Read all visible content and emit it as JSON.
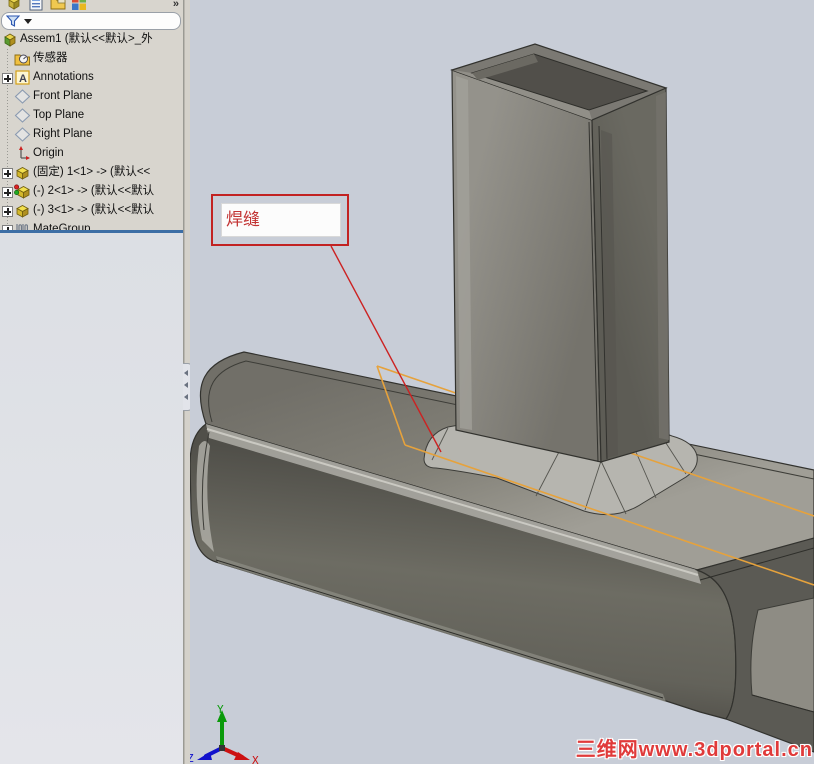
{
  "left_panel": {
    "toolbar": {
      "icons": [
        "feature-manager-icon",
        "property-manager-icon",
        "configuration-manager-icon",
        "addins-manager-icon"
      ],
      "overflow_label": "»"
    },
    "filter": {
      "icon": "filter-funnel-icon"
    },
    "tree": {
      "items": [
        {
          "icon": "assembly-icon",
          "label": "Assem1 (默认<<默认>_外",
          "expandable": false,
          "root": true
        },
        {
          "icon": "sensors-icon",
          "label": "传感器",
          "expandable": false
        },
        {
          "icon": "annotations-icon",
          "label": "Annotations",
          "expandable": true
        },
        {
          "icon": "plane-icon",
          "label": "Front Plane",
          "expandable": false
        },
        {
          "icon": "plane-icon",
          "label": "Top Plane",
          "expandable": false
        },
        {
          "icon": "plane-icon",
          "label": "Right Plane",
          "expandable": false
        },
        {
          "icon": "origin-icon",
          "label": "Origin",
          "expandable": false
        },
        {
          "icon": "part-icon",
          "label": "(固定) 1<1> -> (默认<<",
          "expandable": true
        },
        {
          "icon": "part-alert-icon",
          "label": "(-) 2<1> -> (默认<<默认",
          "expandable": true
        },
        {
          "icon": "part-icon",
          "label": "(-) 3<1> -> (默认<<默认",
          "expandable": true
        },
        {
          "icon": "mategroup-icon",
          "label": "MateGroup",
          "expandable": true
        }
      ]
    }
  },
  "viewport": {
    "annotation": {
      "text": "焊缝"
    },
    "triad": {
      "x_label": "X",
      "y_label": "Y",
      "z_label": "Z"
    },
    "watermark": "三维网www.3dportal.cn",
    "colors": {
      "annotation_red": "#cc2222",
      "sketch_highlight_orange": "#e6a23c",
      "weld_fillet_grey": "#b6b5af",
      "model_grey": "#6b6a62",
      "viewport_background": "#c8cdd7",
      "splitter_blue": "#3c6ea5",
      "triad_x_red": "#cc1111",
      "triad_y_green": "#0a9a0a",
      "triad_z_blue": "#1111cc",
      "watermark_red": "#e03a3a"
    }
  }
}
